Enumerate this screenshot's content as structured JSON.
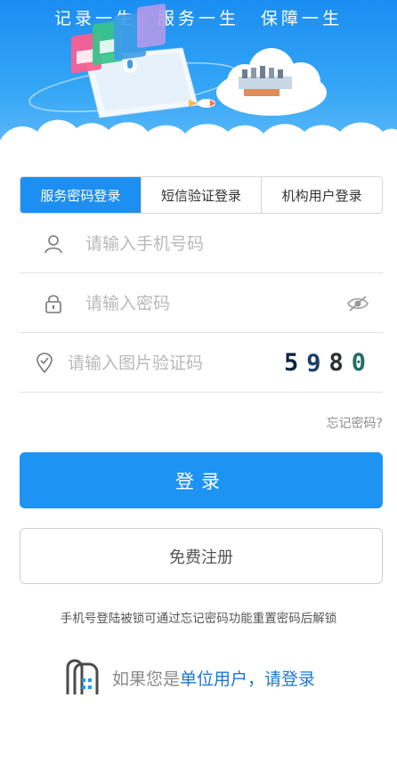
{
  "banner": {
    "slogan": "记录一生  服务一生  保障一生"
  },
  "tabs": [
    {
      "label": "服务密码登录",
      "active": true
    },
    {
      "label": "短信验证登录",
      "active": false
    },
    {
      "label": "机构用户登录",
      "active": false
    }
  ],
  "form": {
    "phone_placeholder": "请输入手机号码",
    "password_placeholder": "请输入密码",
    "captcha_placeholder": "请输入图片验证码",
    "captcha_code": [
      "5",
      "9",
      "8",
      "0"
    ]
  },
  "links": {
    "forgot_password": "忘记密码?"
  },
  "buttons": {
    "login": "登录",
    "register": "免费注册"
  },
  "hint": "手机号登陆被锁可通过忘记密码功能重置密码后解锁",
  "unit_login": {
    "prefix": "如果您是",
    "link": "单位用户，请登录"
  },
  "colors": {
    "primary": "#1d93f3",
    "banner_top": "#1a8ef2",
    "link": "#1b77d2"
  }
}
